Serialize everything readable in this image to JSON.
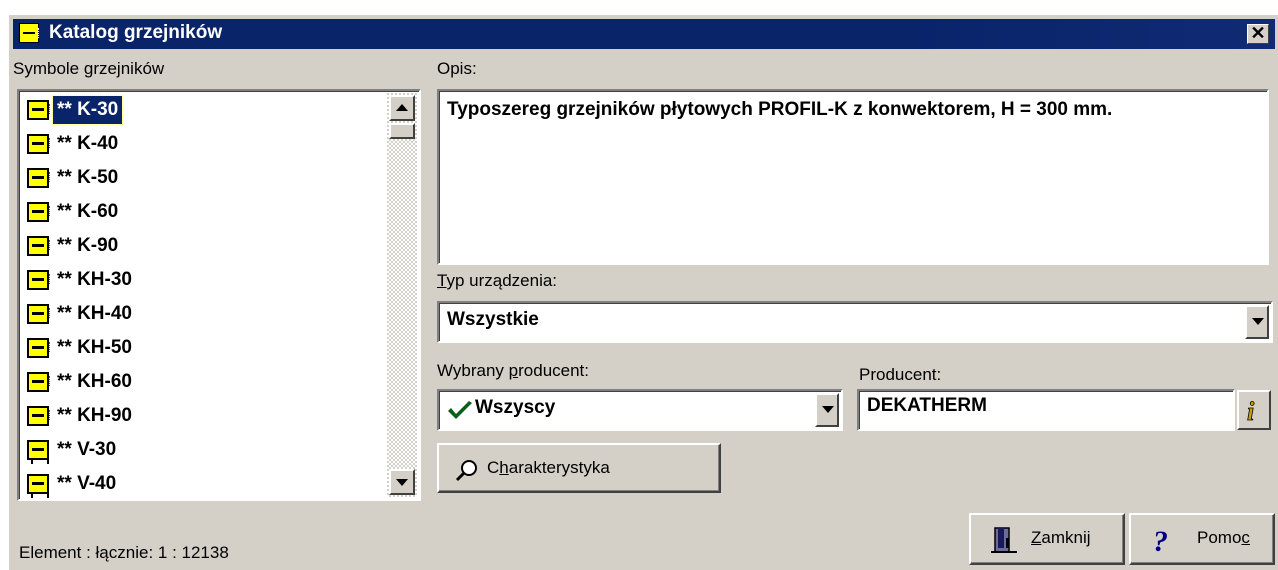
{
  "window": {
    "title": "Katalog grzejników",
    "close_label": "✕"
  },
  "list": {
    "label": "Symbole grzejników",
    "items": [
      {
        "label": "** K-30",
        "icon": "radiator-icon",
        "selected": true
      },
      {
        "label": "** K-40",
        "icon": "radiator-icon"
      },
      {
        "label": "** K-50",
        "icon": "radiator-icon"
      },
      {
        "label": "** K-60",
        "icon": "radiator-icon"
      },
      {
        "label": "** K-90",
        "icon": "radiator-icon"
      },
      {
        "label": "** KH-30",
        "icon": "radiator-icon"
      },
      {
        "label": "** KH-40",
        "icon": "radiator-icon"
      },
      {
        "label": "** KH-50",
        "icon": "radiator-icon"
      },
      {
        "label": "** KH-60",
        "icon": "radiator-icon"
      },
      {
        "label": "** KH-90",
        "icon": "radiator-icon"
      },
      {
        "label": "** V-30",
        "icon": "radiator-valve-icon"
      },
      {
        "label": "** V-40",
        "icon": "radiator-valve-icon"
      }
    ]
  },
  "opis": {
    "label": "Opis:",
    "text": "Typoszereg grzejników płytowych PROFIL-K z konwektorem, H = 300 mm."
  },
  "typ": {
    "label_mnemonic": "T",
    "label_rest": "yp urządzenia:",
    "value": "Wszystkie"
  },
  "wybrany": {
    "label_before": "Wybrany ",
    "label_mnemonic": "p",
    "label_after": "roducent:",
    "value": "Wszyscy"
  },
  "producent": {
    "label": "Producent:",
    "value": "DEKATHERM"
  },
  "buttons": {
    "charakterystyka": {
      "before": "C",
      "mnemonic": "h",
      "after": "arakterystyka"
    },
    "zamknij": {
      "mnemonic": "Z",
      "after": "amknij"
    },
    "pomoc": {
      "before": "Pomo",
      "mnemonic": "c"
    }
  },
  "status": {
    "text": "Element : łącznie: 1 : 12138"
  },
  "colors": {
    "titlebar": "#0a246a",
    "face": "#d4d0c8",
    "selection": "#0a246a",
    "icon_yellow": "#ffff00"
  }
}
